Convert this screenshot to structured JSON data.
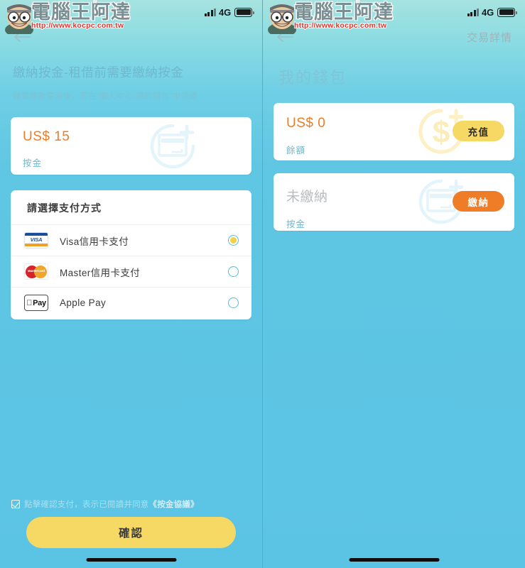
{
  "watermark": {
    "title": "電腦王阿達",
    "url": "http://www.kocpc.com.tw",
    "crown_icon": "crown-icon",
    "face_icon": "cartoon-face-icon"
  },
  "statusbar": {
    "signal_icon": "signal-bars-icon",
    "network": "4G",
    "battery_icon": "battery-full-icon"
  },
  "left_screen": {
    "nav": {
      "back_icon": "back-arrow-icon",
      "right_action": ""
    },
    "heading": "繳納按金-租借前需要繳納按金",
    "subheading": "歸還移動電源後，可在“個人中心-我的錢包”中退還",
    "amount_card": {
      "amount": "US$ 15",
      "label": "按金",
      "deco_icon": "card-plus-circle-icon"
    },
    "payment": {
      "title": "請選擇支付方式",
      "methods": [
        {
          "logo": "visa-logo-icon",
          "logo_text": "VISA",
          "name": "Visa信用卡支付",
          "selected": true
        },
        {
          "logo": "mastercard-logo-icon",
          "logo_text": "MasterCard",
          "name": "Master信用卡支付",
          "selected": false
        },
        {
          "logo": "apple-pay-logo-icon",
          "logo_text": "Pay",
          "name": "Apple Pay",
          "selected": false
        }
      ]
    },
    "agreement": {
      "checkbox_icon": "checkbox-checked-icon",
      "checked": true,
      "text": "點擊確認支付，表示已閱讀并同意",
      "doc_link": "《按金協議》"
    },
    "confirm_label": "確認",
    "home_indicator_icon": "home-indicator"
  },
  "right_screen": {
    "nav": {
      "back_icon": "back-arrow-icon",
      "right_action": "交易詳情"
    },
    "title": "我的錢包",
    "cards": [
      {
        "value": "US$ 0",
        "label": "餘額",
        "button": "充值",
        "button_style": "topup",
        "deco_icon": "dollar-plus-circle-icon",
        "muted": false
      },
      {
        "value": "未繳納",
        "label": "按金",
        "button": "繳納",
        "button_style": "pay",
        "deco_icon": "card-plus-circle-icon",
        "muted": true
      }
    ],
    "home_indicator_icon": "home-indicator"
  },
  "colors": {
    "background": "#5fc6e3",
    "background_top": "#a6e3e0",
    "accent_orange": "#ef7c26",
    "accent_yellow": "#f5d964",
    "radio_ring": "#4fc0df",
    "label_blue": "#6fb9cf",
    "card_white": "#ffffff",
    "watermark_red": "#e0352b"
  }
}
